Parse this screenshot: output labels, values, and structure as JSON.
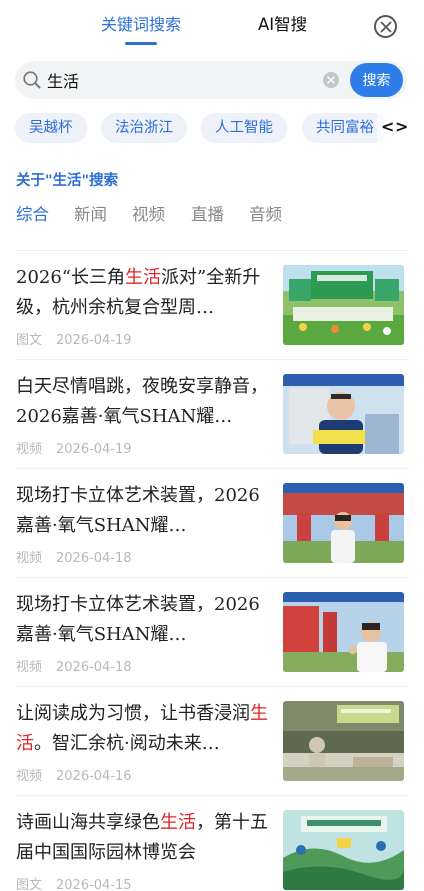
{
  "top_tabs": [
    {
      "label": "关键词搜索",
      "active": true
    },
    {
      "label": "AI智搜",
      "active": false
    }
  ],
  "search": {
    "value": "生活",
    "placeholder": "",
    "button_label": "搜索"
  },
  "hot_keywords": [
    "吴越杯",
    "法治浙江",
    "人工智能",
    "共同富裕"
  ],
  "chip_arrows": {
    "left": "<",
    "right": ">"
  },
  "results_header": {
    "about_text": "关于\"生活\"搜索",
    "category_tabs": [
      {
        "label": "综合",
        "active": true
      },
      {
        "label": "新闻",
        "active": false
      },
      {
        "label": "视频",
        "active": false
      },
      {
        "label": "直播",
        "active": false
      },
      {
        "label": "音频",
        "active": false
      }
    ]
  },
  "results": [
    {
      "title_parts": [
        "2026“长三角",
        "生活",
        "派对”全新升级，杭州余杭复合型周…"
      ],
      "type": "图文",
      "date": "2026-04-19",
      "thumb": "park-event-green"
    },
    {
      "title_parts": [
        "白天尽情唱跳，夜晚安享静音，2026嘉善·氧气SHAN耀…",
        "",
        ""
      ],
      "type": "视频",
      "date": "2026-04-19",
      "thumb": "man-portrait-video"
    },
    {
      "title_parts": [
        "现场打卡立体艺术装置，2026嘉善·氧气SHAN耀…",
        "",
        ""
      ],
      "type": "视频",
      "date": "2026-04-18",
      "thumb": "woman-art-installation"
    },
    {
      "title_parts": [
        "现场打卡立体艺术装置，2026嘉善·氧气SHAN耀…",
        "",
        ""
      ],
      "type": "视频",
      "date": "2026-04-18",
      "thumb": "woman-red-gate"
    },
    {
      "title_parts": [
        "让阅读成为习惯，让书香浸润",
        "生活",
        "。智汇余杭·阅动未来…"
      ],
      "type": "视频",
      "date": "2026-04-16",
      "thumb": "reading-event-statue"
    },
    {
      "title_parts": [
        "诗画山海共享绿色",
        "生活",
        "，第十五届中国国际园林博览会"
      ],
      "type": "图文",
      "date": "2026-04-15",
      "thumb": "garden-expo-poster"
    }
  ],
  "colors": {
    "accent": "#2e6fd8",
    "highlight": "#e0262b",
    "search_button": "#2f7de9"
  }
}
